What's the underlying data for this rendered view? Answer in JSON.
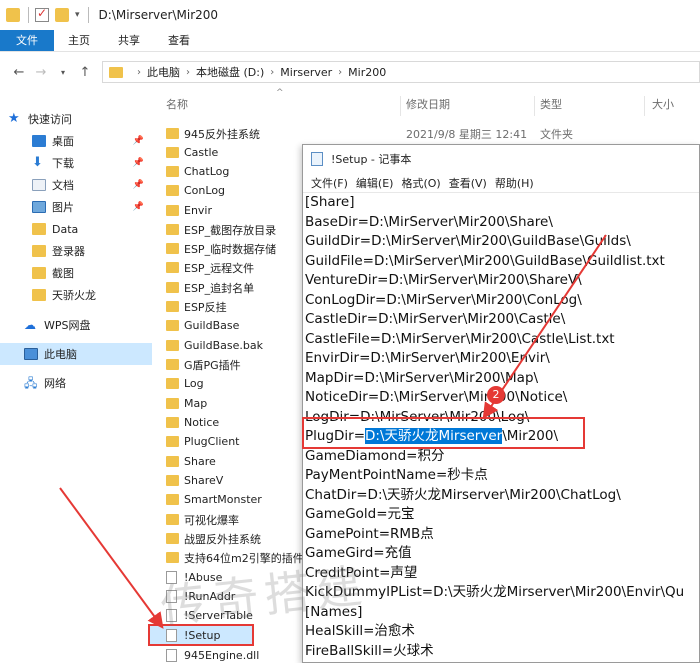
{
  "window": {
    "title": "D:\\Mirserver\\Mir200"
  },
  "ribbon": {
    "tabs": [
      "文件",
      "主页",
      "共享",
      "查看"
    ]
  },
  "address": {
    "crumbs": [
      "此电脑",
      "本地磁盘 (D:)",
      "Mirserver",
      "Mir200"
    ]
  },
  "sidebar": {
    "items": [
      {
        "label": "快速访问",
        "icon": "star-icon"
      },
      {
        "label": "桌面",
        "icon": "desktop-icon"
      },
      {
        "label": "下载",
        "icon": "download-icon"
      },
      {
        "label": "文档",
        "icon": "documents-icon"
      },
      {
        "label": "图片",
        "icon": "pictures-icon"
      },
      {
        "label": "Data",
        "icon": "folder-icon"
      },
      {
        "label": "登录器",
        "icon": "folder-icon"
      },
      {
        "label": "截图",
        "icon": "folder-icon"
      },
      {
        "label": "天骄火龙",
        "icon": "folder-icon"
      },
      {
        "label": "WPS网盘",
        "icon": "cloud-icon"
      },
      {
        "label": "此电脑",
        "icon": "computer-icon"
      },
      {
        "label": "网络",
        "icon": "network-icon"
      }
    ]
  },
  "columns": {
    "name": "名称",
    "date": "修改日期",
    "type": "类型",
    "size": "大小"
  },
  "files": [
    "945反外挂系统",
    "Castle",
    "ChatLog",
    "ConLog",
    "Envir",
    "ESP_截图存放目录",
    "ESP_临时数据存储",
    "ESP_远程文件",
    "ESP_追封名单",
    "ESP反挂",
    "GuildBase",
    "GuildBase.bak",
    "G盾PG插件",
    "Log",
    "Map",
    "Notice",
    "PlugClient",
    "Share",
    "ShareV",
    "SmartMonster",
    "可视化爆率",
    "战盟反外挂系统",
    "支持64位m2引擎的插件",
    "!Abuse",
    "!RunAddr",
    "!ServerTable",
    "!Setup",
    "945Engine.dll"
  ],
  "first_row": {
    "date": "2021/9/8 星期三 12:41",
    "type": "文件夹"
  },
  "notepad": {
    "title": "!Setup - 记事本",
    "menu": [
      "文件(F)",
      "编辑(E)",
      "格式(O)",
      "查看(V)",
      "帮助(H)"
    ],
    "lines": [
      "[Share]",
      "BaseDir=D:\\MirServer\\Mir200\\Share\\",
      "GuildDir=D:\\MirServer\\Mir200\\GuildBase\\Guilds\\",
      "GuildFile=D:\\MirServer\\Mir200\\GuildBase\\Guildlist.txt",
      "VentureDir=D:\\MirServer\\Mir200\\ShareV\\",
      "ConLogDir=D:\\MirServer\\Mir200\\ConLog\\",
      "CastleDir=D:\\MirServer\\Mir200\\Castle\\",
      "CastleFile=D:\\MirServer\\Mir200\\Castle\\List.txt",
      "EnvirDir=D:\\MirServer\\Mir200\\Envir\\",
      "MapDir=D:\\MirServer\\Mir200\\Map\\",
      "NoticeDir=D:\\MirServer\\Mir200\\Notice\\",
      "LogDir=D:\\MirServer\\Mir200\\Log\\",
      "PLUGDIR",
      "GameDiamond=积分",
      "PayMentPointName=秒卡点",
      "ChatDir=D:\\天骄火龙Mirserver\\Mir200\\ChatLog\\",
      "GameGold=元宝",
      "GamePoint=RMB点",
      "GameGird=充值",
      "CreditPoint=声望",
      "KickDummyIPList=D:\\天骄火龙Mirserver\\Mir200\\Envir\\Qu",
      "[Names]",
      "HealSkill=治愈术",
      "FireBallSkill=火球术"
    ],
    "plug_prefix": "PlugDir=",
    "plug_selected": "D:\\天骄火龙Mirserver",
    "plug_suffix": "\\Mir200\\"
  },
  "annotation": {
    "badge": "2"
  },
  "watermark": "传奇搭建"
}
